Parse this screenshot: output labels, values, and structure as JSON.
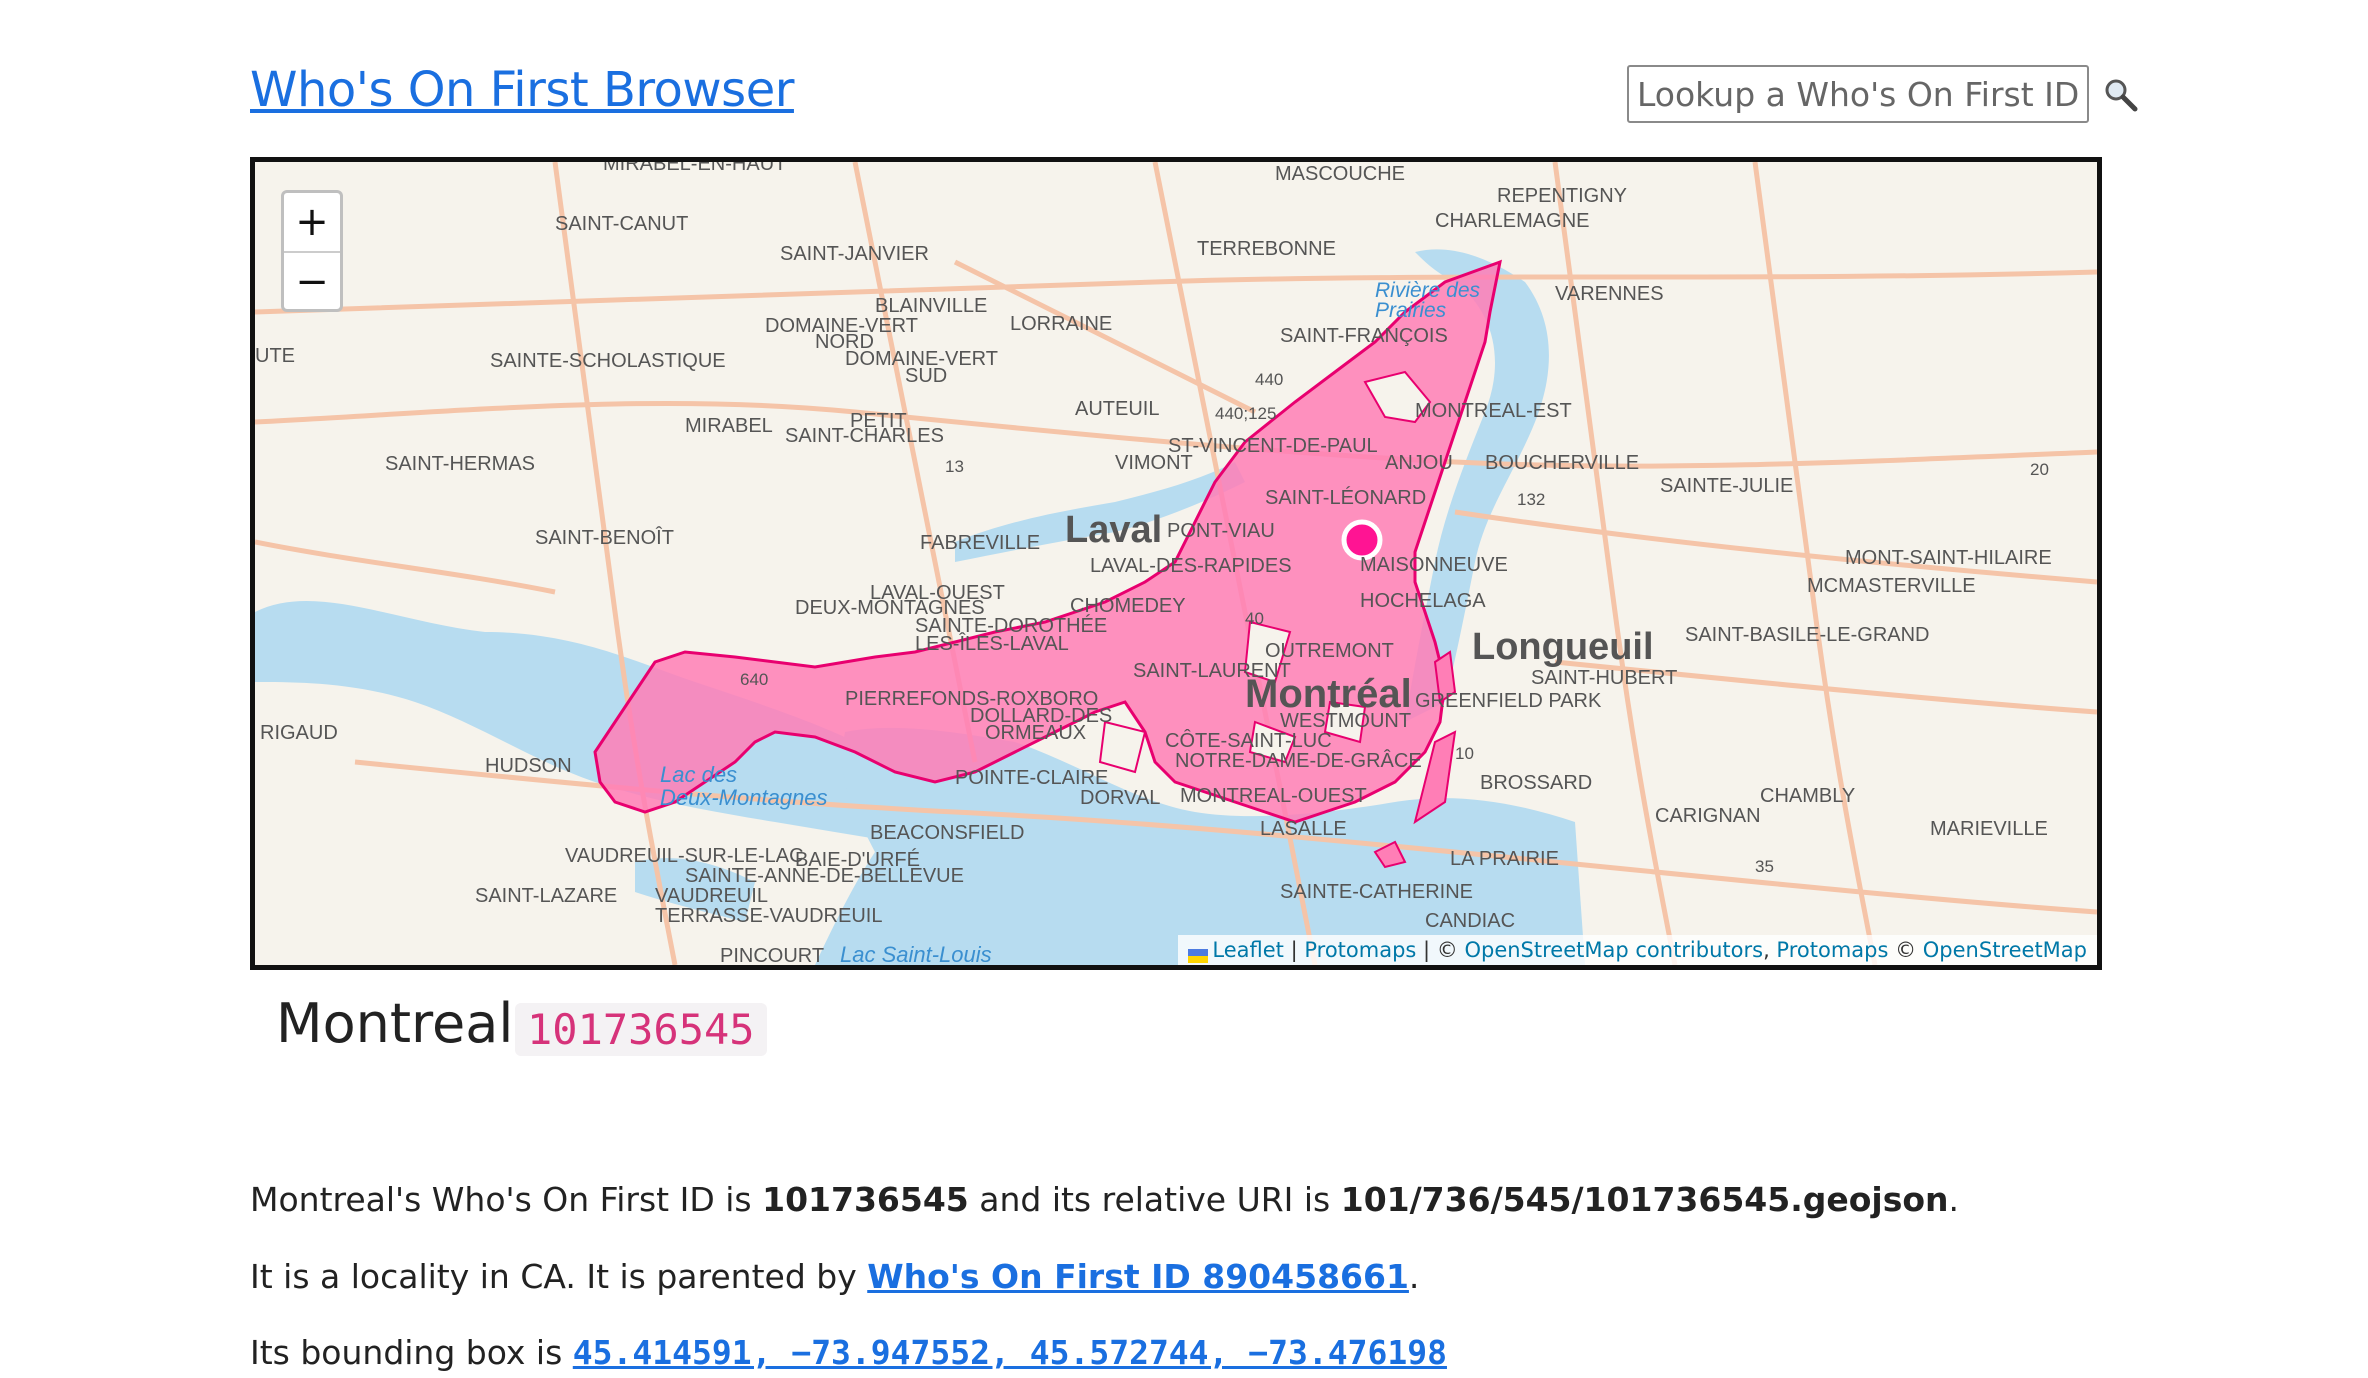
{
  "header": {
    "title": "Who's On First Browser",
    "search_placeholder": "Lookup a Who's On First ID"
  },
  "map": {
    "zoom_in": "+",
    "zoom_out": "−",
    "attribution": {
      "leaflet": "Leaflet",
      "sep1": " | ",
      "protomaps1": "Protomaps",
      "sep2": " | © ",
      "osm": "OpenStreetMap contributors",
      "comma": ", ",
      "protomaps2": "Protomaps",
      "copy": " © ",
      "osm2": "OpenStreetMap"
    },
    "labels": {
      "mirabel_en_haut": "MIRABEL-EN-HAUT",
      "mascouche": "MASCOUCHE",
      "saint_canut": "SAINT-CANUT",
      "repentigny": "REPENTIGNY",
      "charlemagne": "CHARLEMAGNE",
      "saint_janvier": "SAINT-JANVIER",
      "terrebonne": "TERREBONNE",
      "riviere_des_prairies_1": "Rivière des",
      "riviere_des_prairies_2": "Prairies",
      "varennes": "VARENNES",
      "blainville": "BLAINVILLE",
      "domaine_vert_nord_1": "DOMAINE-VERT",
      "domaine_vert_nord_2": "NORD",
      "lorraine": "LORRAINE",
      "saint_francois": "SAINT-FRANÇOIS",
      "ute": "UTE",
      "sainte_scholastique": "SAINTE-SCHOLASTIQUE",
      "domaine_vert_sud_1": "DOMAINE-VERT",
      "domaine_vert_sud_2": "SUD",
      "r440": "440",
      "auteuil": "AUTEUIL",
      "r440_125": "440;125",
      "montreal_est": "MONTREAL-EST",
      "mirabel": "MIRABEL",
      "petit_1": "PETIT",
      "saint_charles": "SAINT-CHARLES",
      "st_vincent": "ST-VINCENT-DE-PAUL",
      "saint_hermas": "SAINT-HERMAS",
      "r13": "13",
      "vimont": "VIMONT",
      "anjou": "ANJOU",
      "boucherville": "BOUCHERVILLE",
      "r20": "20",
      "sainte_julie": "SAINTE-JULIE",
      "saint_leonard": "SAINT-LÉONARD",
      "r132": "132",
      "laval": "Laval",
      "pont_viau": "PONT-VIAU",
      "saint_benoit": "SAINT-BENOÎT",
      "fabreville": "FABREVILLE",
      "maisonneuve": "MAISONNEUVE",
      "mont_saint_hilaire": "MONT-SAINT-HILAIRE",
      "laval_des_rapides": "LAVAL-DES-RAPIDES",
      "mcmasterville": "MCMASTERVILLE",
      "laval_ouest": "LAVAL-OUEST",
      "hochelaga": "HOCHELAGA",
      "deux_montagnes": "DEUX-MONTAGNES",
      "chomedey": "CHOMEDEY",
      "sainte_dorothee": "SAINTE-DOROTHÉE",
      "les_iles_laval": "LES-ÎLES-LAVAL",
      "r40": "40",
      "outremont": "OUTREMONT",
      "longueuil": "Longueuil",
      "saint_basile": "SAINT-BASILE-LE-GRAND",
      "saint_laurent": "SAINT-LAURENT",
      "saint_hubert": "SAINT-HUBERT",
      "r640": "640",
      "montreal": "Montréal",
      "pierrefonds": "PIERREFONDS-ROXBORO",
      "greenfield_park": "GREENFIELD PARK",
      "dollard": "DOLLARD-DES",
      "ormeaux": "ORMEAUX",
      "westmount": "WESTMOUNT",
      "rigaud": "RIGAUD",
      "cote_saint_luc": "CÔTE-SAINT-LUC",
      "r10": "10",
      "hudson": "HUDSON",
      "notre_dame": "NOTRE-DAME-DE-GRÂCE",
      "lac_des_1": "Lac des",
      "lac_des_2": "Deux-Montagnes",
      "pointe_claire": "POINTE-CLAIRE",
      "brossard": "BROSSARD",
      "montreal_ouest": "MONTREAL-OUEST",
      "dorval": "DORVAL",
      "chambly": "CHAMBLY",
      "carignan": "CARIGNAN",
      "lasalle": "LASALLE",
      "marieville": "MARIEVILLE",
      "beaconsfield": "BEACONSFIELD",
      "vaudreuil_sur_le_lac": "VAUDREUIL-SUR-LE-LAC",
      "baie_d_urfe": "BAIE-D'URFÉ",
      "la_prairie": "LA PRAIRIE",
      "r35": "35",
      "sainte_anne": "SAINTE-ANNE-DE-BELLEVUE",
      "saint_lazare": "SAINT-LAZARE",
      "vaudreuil_1": "VAUDREUIL",
      "vaudreuil_2": "TERRASSE-VAUDREUIL",
      "sainte_catherine": "SAINTE-CATHERINE",
      "candiac": "CANDIAC",
      "pincourt": "PINCOURT",
      "lac_saint_louis": "Lac Saint-Louis"
    }
  },
  "place": {
    "name": "Montreal",
    "id": "101736545"
  },
  "description": {
    "p1_pre": "Montreal's Who's On First ID is ",
    "p1_id": "101736545",
    "p1_mid": " and its relative URI is ",
    "p1_uri": "101/736/545/101736545.geojson",
    "p1_end": ".",
    "p2_pre": "It is a locality in CA. It is parented by ",
    "p2_link": "Who's On First ID 890458661",
    "p2_end": ".",
    "p3_pre": "Its bounding box is ",
    "p3_bbox": "45.414591, −73.947552, 45.572744, −73.476198"
  },
  "colors": {
    "link": "#1a6fe0",
    "polygon_fill": "#ff7eb6",
    "polygon_stroke": "#e8006f",
    "marker": "#ff1493",
    "water": "#b7dcf0",
    "road": "#f5c4a8"
  }
}
